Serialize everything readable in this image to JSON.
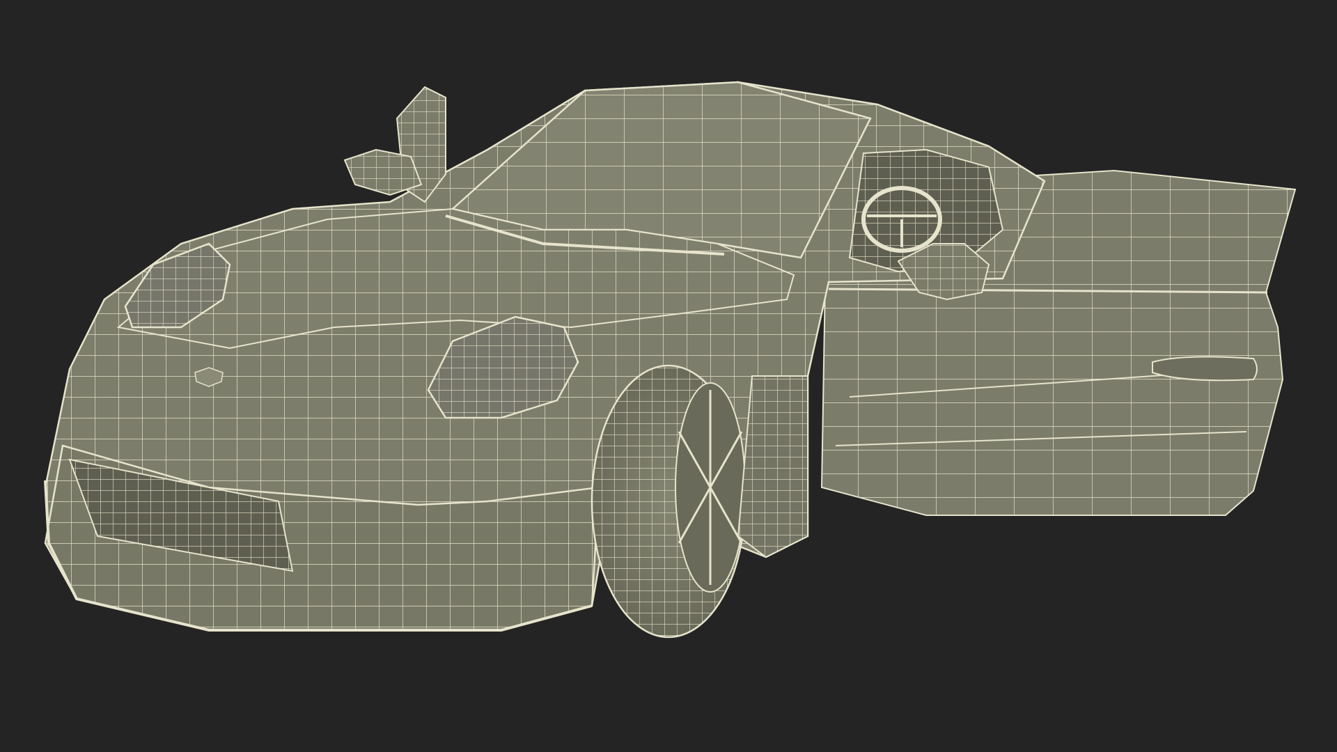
{
  "scene": {
    "subject": "sports-car-wireframe-model",
    "view": "front-three-quarter",
    "doors_open": true
  },
  "colors": {
    "background": "#242424",
    "surface": "#7d7d6c",
    "surface_dark": "#6e6e5e",
    "surface_light": "#8a8a78",
    "wire": "#e6e4cc",
    "shadow": "#5e5e50"
  }
}
